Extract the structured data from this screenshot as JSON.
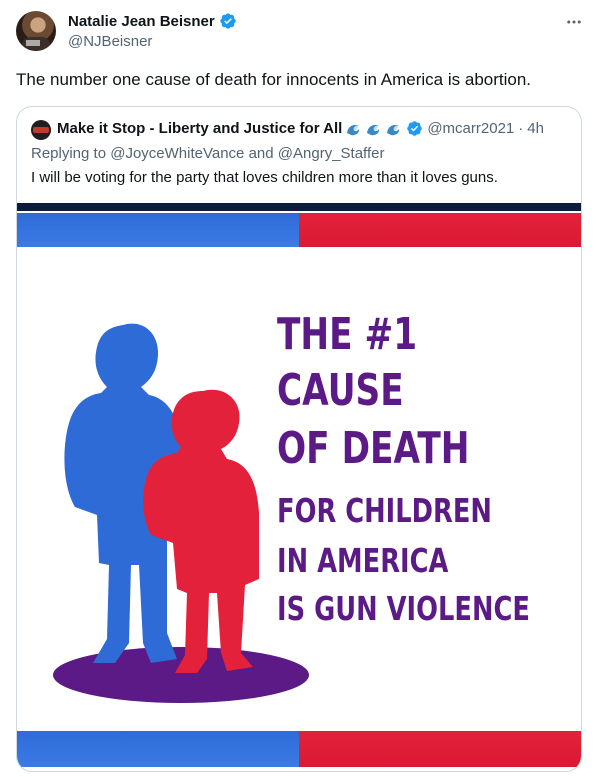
{
  "tweet": {
    "author": {
      "display_name": "Natalie Jean Beisner",
      "handle": "@NJBeisner",
      "verified": true
    },
    "more_icon": "more-horizontal-icon",
    "text": "The number one cause of death for innocents in America is abortion."
  },
  "quote": {
    "author": {
      "display_name": "Make it Stop - Liberty and Justice for All",
      "emoji": [
        "wave-emoji",
        "wave-emoji",
        "wave-emoji"
      ],
      "handle": "@mcarr2021",
      "separator": "·",
      "time": "4h",
      "verified": true
    },
    "replying_prefix": "Replying to ",
    "replying_to_1": "@JoyceWhiteVance",
    "replying_and": " and ",
    "replying_to_2": "@Angry_Staffer",
    "text": "I will be voting for the party that loves children more than it loves guns.",
    "image": {
      "line1": "THE #1",
      "line2": "CAUSE",
      "line3": "OF DEATH",
      "line4": "FOR CHILDREN",
      "line5": "IN AMERICA",
      "line6": "IS GUN VIOLENCE"
    }
  },
  "colors": {
    "brand_blue": "#1d9bf0",
    "poster_purple": "#5b1a86",
    "poster_blue": "#2f6bd6",
    "poster_red": "#e3213a"
  }
}
